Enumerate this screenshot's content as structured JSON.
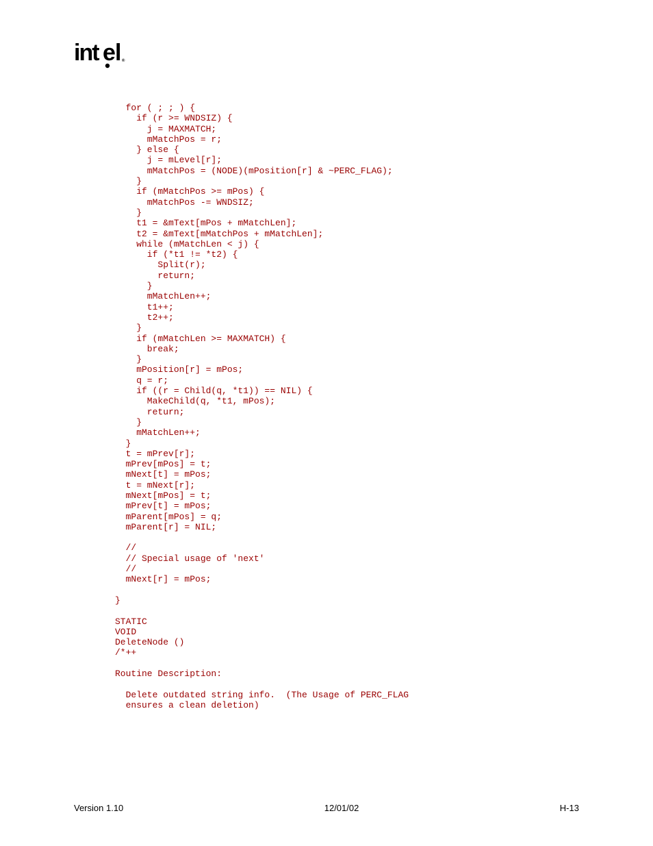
{
  "logo": {
    "text": "intel"
  },
  "code": {
    "lines": [
      "  for ( ; ; ) {",
      "    if (r >= WNDSIZ) {",
      "      j = MAXMATCH;",
      "      mMatchPos = r;",
      "    } else {",
      "      j = mLevel[r];",
      "      mMatchPos = (NODE)(mPosition[r] & ~PERC_FLAG);",
      "    }",
      "    if (mMatchPos >= mPos) {",
      "      mMatchPos -= WNDSIZ;",
      "    }",
      "    t1 = &mText[mPos + mMatchLen];",
      "    t2 = &mText[mMatchPos + mMatchLen];",
      "    while (mMatchLen < j) {",
      "      if (*t1 != *t2) {",
      "        Split(r);",
      "        return;",
      "      }",
      "      mMatchLen++;",
      "      t1++;",
      "      t2++;",
      "    }",
      "    if (mMatchLen >= MAXMATCH) {",
      "      break;",
      "    }",
      "    mPosition[r] = mPos;",
      "    q = r;",
      "    if ((r = Child(q, *t1)) == NIL) {",
      "      MakeChild(q, *t1, mPos);",
      "      return;",
      "    }",
      "    mMatchLen++;",
      "  }",
      "  t = mPrev[r];",
      "  mPrev[mPos] = t;",
      "  mNext[t] = mPos;",
      "  t = mNext[r];",
      "  mNext[mPos] = t;",
      "  mPrev[t] = mPos;",
      "  mParent[mPos] = q;",
      "  mParent[r] = NIL;",
      "  ",
      "  //",
      "  // Special usage of 'next'",
      "  //",
      "  mNext[r] = mPos;",
      "",
      "}",
      "",
      "STATIC",
      "VOID",
      "DeleteNode ()",
      "/*++",
      "",
      "Routine Description:",
      "",
      "  Delete outdated string info.  (The Usage of PERC_FLAG",
      "  ensures a clean deletion)"
    ]
  },
  "footer": {
    "version": "Version 1.10",
    "date": "12/01/02",
    "page": "H-13"
  }
}
